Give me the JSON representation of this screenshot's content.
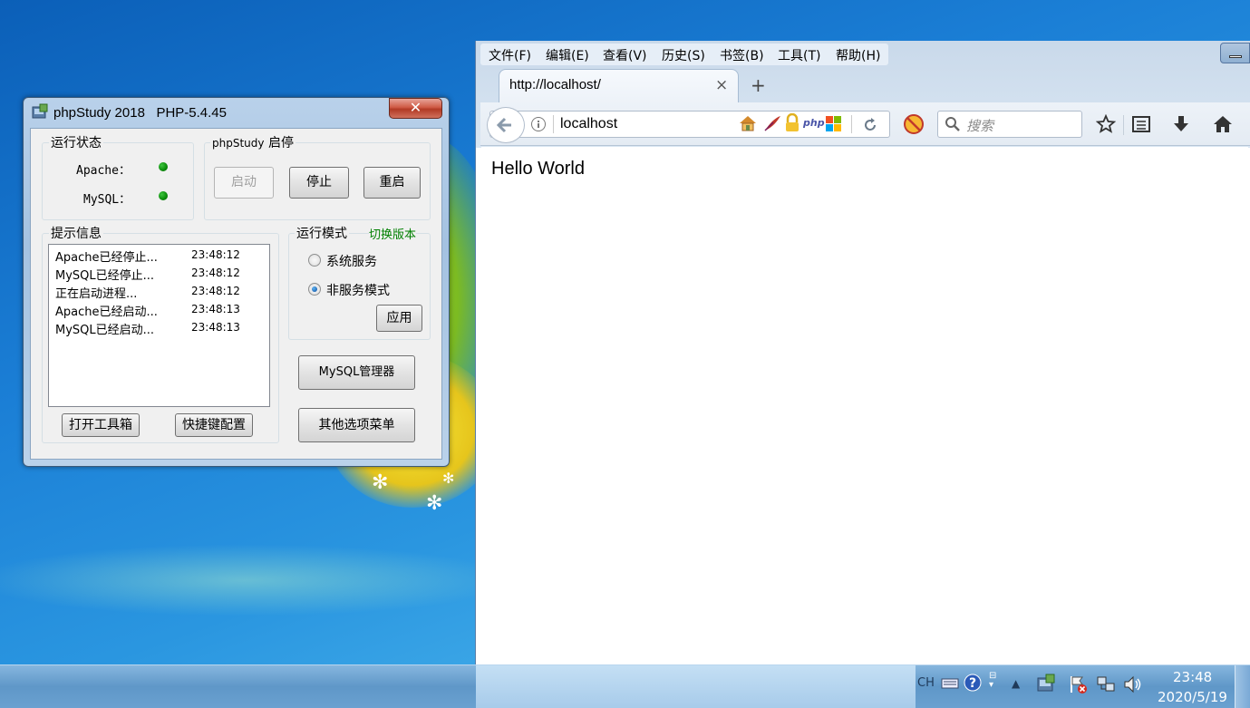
{
  "phpstudy": {
    "title": "phpStudy 2018",
    "php_version": "PHP-5.4.45",
    "close_label": "✕",
    "status_group": {
      "label": "运行状态",
      "apache_label": "Apache：",
      "mysql_label": "MySQL：",
      "apache_status_color": "#0a8a0a",
      "mysql_status_color": "#0a8a0a"
    },
    "control_group": {
      "label_prefix": "phpStudy",
      "label_suffix": "启停",
      "start": "启动",
      "stop": "停止",
      "restart": "重启"
    },
    "log_group": {
      "label": "提示信息",
      "rows": [
        {
          "msg": "Apache已经停止...",
          "time": "23:48:12"
        },
        {
          "msg": "MySQL已经停止...",
          "time": "23:48:12"
        },
        {
          "msg": "正在启动进程...",
          "time": "23:48:12"
        },
        {
          "msg": "Apache已经启动...",
          "time": "23:48:13"
        },
        {
          "msg": "MySQL已经启动...",
          "time": "23:48:13"
        }
      ],
      "open_toolbox": "打开工具箱",
      "shortcut_config": "快捷键配置"
    },
    "mode_group": {
      "label": "运行模式",
      "switch_version": "切换版本",
      "system_service": "系统服务",
      "non_service": "非服务模式",
      "selected": "非服务模式",
      "apply": "应用"
    },
    "mysql_manager": "MySQL管理器",
    "other_options": "其他选项菜单"
  },
  "browser": {
    "menu": [
      "文件(F)",
      "编辑(E)",
      "查看(V)",
      "历史(S)",
      "书签(B)",
      "工具(T)",
      "帮助(H)"
    ],
    "tab_title": "http://localhost/",
    "tab_close": "×",
    "new_tab": "+",
    "url": "localhost",
    "search_placeholder": "搜索",
    "page_text": "Hello World"
  },
  "taskbar": {
    "lang": "CH",
    "time": "23:48",
    "date": "2020/5/19"
  },
  "colors": {
    "accent_green": "#0a8a0a",
    "switch_version_color": "#008000"
  }
}
